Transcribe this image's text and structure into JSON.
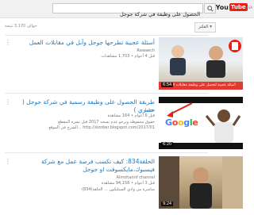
{
  "header": {
    "logo_you": "You",
    "logo_tube": "Tube",
    "logo_locale": "SA",
    "search_value": "الحصول على وظيفة في شركة جوجل"
  },
  "filter": {
    "label": "الفلتر",
    "results": "حوالى 3,170 نتيجة"
  },
  "results": [
    {
      "title": "أسئلة عجيبة تطرحها جوجل وآبل في مقابلات العمل",
      "channel": "Rawaech",
      "stats": "قبل 4 أعوام • 1,703 مشاهدات",
      "desc_lines": [],
      "duration": "6:54",
      "thumb_caption": "أسئلة عجيبة لتحصل على وظيفة مقابلات العمل"
    },
    {
      "title": "طريقة الحصول على وظيفة رسمية في شركة جوجل ( حصري )",
      "channel": "بيجانيك",
      "stats": "قبل 6 أعوام • 164 مشاهدة",
      "desc_lines": [
        "حقوق محفوظة ونرجو عدم نسخه 2017 قبل نشره المقطع",
        "http://sizober.blogspot.com/2017/01 ...الشرح في الموقع"
      ],
      "duration": "6:20",
      "thumb_caption": "Google"
    },
    {
      "title": "الحلقة834: كيف تكسب فرصة عمل مع شركة فيسبوك،مايكسوفت او جوجل",
      "channel": "Almohannf channel",
      "stats": "قبل 3 أعوام • 94,158 مشاهدة",
      "desc_lines": [
        "مباشرة من وادي السيليكون ... الحلقة(834)"
      ],
      "duration": "9:24",
      "thumb_caption": ""
    }
  ],
  "colors": {
    "link": "#167ac6",
    "brand_red": "#e62117"
  }
}
